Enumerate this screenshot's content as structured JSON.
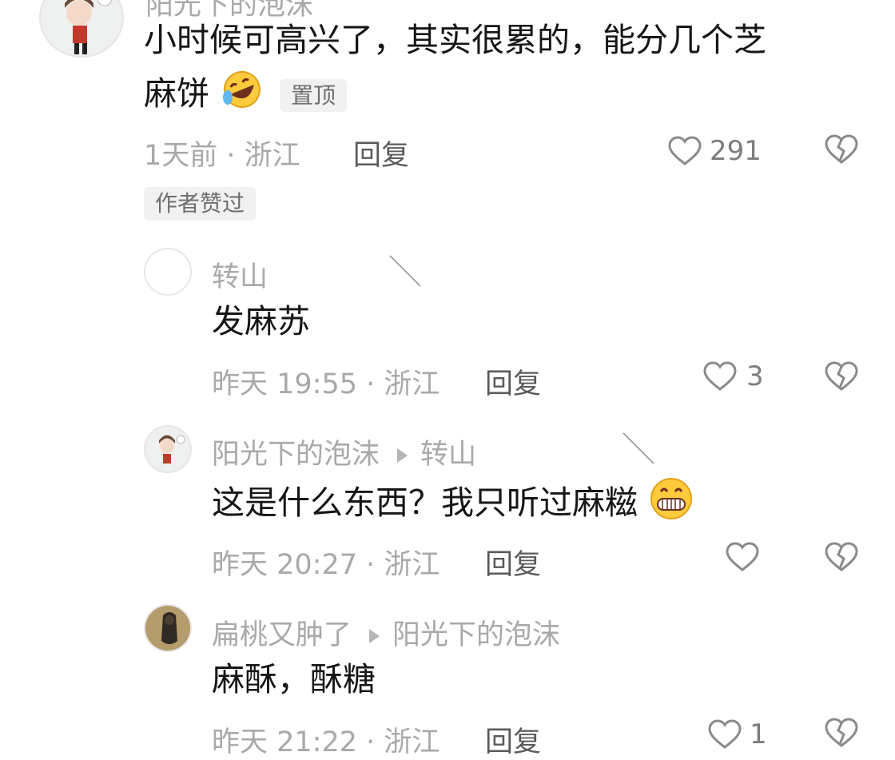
{
  "comments": [
    {
      "user": "阳光下的泡沫",
      "text_line1": "小时候可高兴了，其实很累的，能分几个芝",
      "text_line2": "麻饼",
      "emoji": "rolling-laughing-emoji",
      "pinned_label": "置顶",
      "meta": "1天前 · 浙江",
      "reply_label": "回复",
      "like_count": "291",
      "author_liked_label": "作者赞过"
    },
    {
      "user": "转山",
      "text": "发麻苏",
      "meta": "昨天 19:55 · 浙江",
      "reply_label": "回复",
      "like_count": "3"
    },
    {
      "user": "阳光下的泡沫",
      "reply_to": "转山",
      "text": "这是什么东西？我只听过麻糍",
      "emoji": "grinning-emoji",
      "meta": "昨天 20:27 · 浙江",
      "reply_label": "回复",
      "like_count": ""
    },
    {
      "user": "扁桃又肿了",
      "reply_to": "阳光下的泡沫",
      "text": "麻酥，酥糖",
      "meta": "昨天 21:22 · 浙江",
      "reply_label": "回复",
      "like_count": "1"
    }
  ],
  "colors": {
    "text": "#161616",
    "secondary": "#a9a9a9",
    "reply": "#5a5a5a",
    "badge_bg": "#f1f1f1"
  },
  "icons": [
    "heart-icon",
    "dislike-broken-heart-icon",
    "reply-arrow-icon"
  ]
}
